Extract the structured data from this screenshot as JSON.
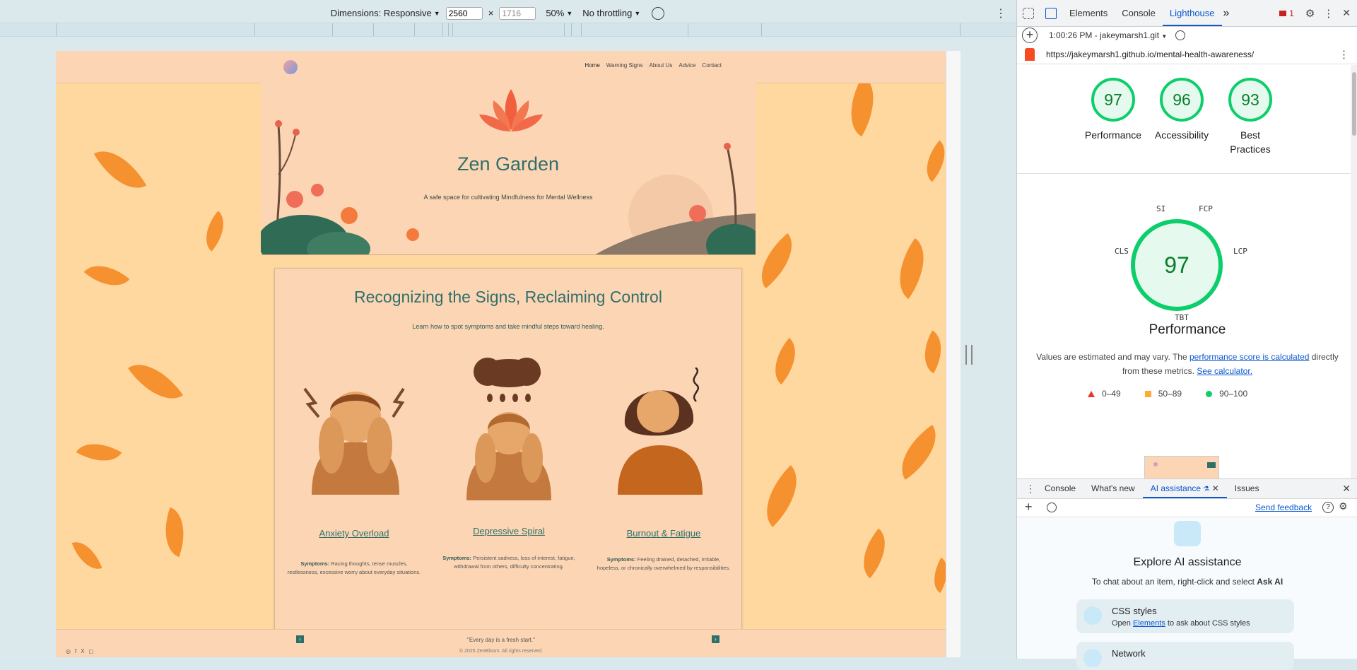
{
  "devbar": {
    "dimensions_label": "Dimensions: Responsive",
    "width": "2560",
    "times": "×",
    "height": "1716",
    "zoom": "50%",
    "throttling": "No throttling"
  },
  "site": {
    "nav": [
      "Home",
      "Warning Signs",
      "About Us",
      "Advice",
      "Contact"
    ],
    "hero_title": "Zen Garden",
    "hero_subtitle": "A safe space for cultivating Mindfulness for Mental Wellness",
    "section_title": "Recognizing the Signs, Reclaiming Control",
    "section_subtitle": "Learn how to spot symptoms and take mindful steps toward healing.",
    "signs": [
      {
        "name": "Anxiety Overload",
        "symptoms_label": "Symptoms:",
        "symptoms": "Racing thoughts, tense muscles, restlessness, excessive worry about everyday situations."
      },
      {
        "name": "Depressive Spiral",
        "symptoms_label": "Symptoms:",
        "symptoms": "Persistent sadness, loss of interest, fatigue, withdrawal from others, difficulty concentrating."
      },
      {
        "name": "Burnout & Fatigue",
        "symptoms_label": "Symptoms:",
        "symptoms": "Feeling drained, detached, irritable, hopeless, or chronically overwhelmed by responsibilities."
      }
    ],
    "quote": "\"Every day is a fresh start.\"",
    "copyright": "© 2025 ZenBloom. All rights reserved."
  },
  "devtools": {
    "tabs": [
      "Elements",
      "Console",
      "Lighthouse"
    ],
    "active_tab": "Lighthouse",
    "more_tabs": "»",
    "issues_count": "1",
    "report_time": "1:00:26 PM - jakeymarsh1.git",
    "url": "https://jakeymarsh1.github.io/mental-health-awareness/",
    "scores": [
      {
        "value": "97",
        "label": "Performance"
      },
      {
        "value": "96",
        "label": "Accessibility"
      },
      {
        "value": "93",
        "label": "Best Practices"
      }
    ],
    "performance": {
      "score": "97",
      "metrics": [
        "SI",
        "FCP",
        "LCP",
        "TBT",
        "CLS"
      ],
      "title": "Performance",
      "note_prefix": "Values are estimated and may vary. The ",
      "note_link": "performance score is calculated",
      "note_mid": " directly from these metrics. ",
      "note_link2": "See calculator.",
      "legend": [
        "0–49",
        "50–89",
        "90–100"
      ]
    },
    "drawer": {
      "tabs": [
        "Console",
        "What's new",
        "AI assistance",
        "Issues"
      ],
      "active_tab": "AI assistance",
      "send_feedback": "Send feedback",
      "ai_title": "Explore AI assistance",
      "ai_desc_prefix": "To chat about an item, right-click and select ",
      "ai_desc_bold": "Ask AI",
      "cards": [
        {
          "title": "CSS styles",
          "desc_prefix": "Open ",
          "desc_link": "Elements",
          "desc_suffix": " to ask about CSS styles"
        },
        {
          "title": "Network"
        }
      ]
    }
  },
  "colors": {
    "accent_blue": "#0b57d0",
    "pass_green": "#0cce6b",
    "site_teal": "#2f6f6a",
    "site_peach": "#fcd6b4",
    "leaf_orange": "#f68d2a"
  }
}
